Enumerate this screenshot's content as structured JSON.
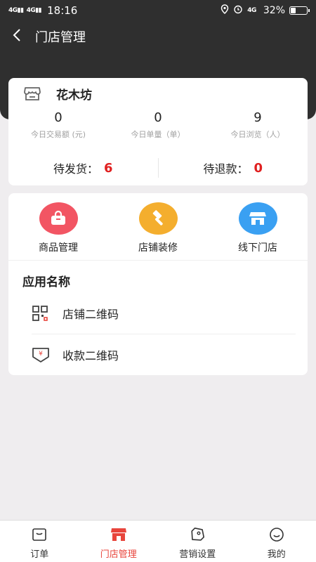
{
  "status_bar": {
    "signal_left": "4G",
    "signal_right": "4G",
    "time": "18:16",
    "network": "4G",
    "battery": "32%",
    "battery_level": 0.32
  },
  "nav": {
    "title": "门店管理"
  },
  "store": {
    "name": "花木坊",
    "stats": [
      {
        "value": "0",
        "label": "今日交易额 (元)"
      },
      {
        "value": "0",
        "label": "今日单量（单）"
      },
      {
        "value": "9",
        "label": "今日浏览（人）"
      }
    ],
    "pending_ship_label": "待发货：",
    "pending_ship_value": "6",
    "pending_refund_label": "待退款：",
    "pending_refund_value": "0"
  },
  "quick_actions": [
    {
      "label": "商品管理",
      "icon": "shopping-bag-icon",
      "color": "#f25563"
    },
    {
      "label": "店铺装修",
      "icon": "hammer-icon",
      "color": "#f4ae2e"
    },
    {
      "label": "线下门店",
      "icon": "storefront-icon",
      "color": "#3aa0f2"
    }
  ],
  "apps": {
    "title": "应用名称",
    "items": [
      {
        "label": "店铺二维码",
        "icon": "qr-code-icon"
      },
      {
        "label": "收款二维码",
        "icon": "payment-qr-icon"
      }
    ]
  },
  "tabs": [
    {
      "label": "订单",
      "icon": "order-icon",
      "active": false
    },
    {
      "label": "门店管理",
      "icon": "store-icon",
      "active": true
    },
    {
      "label": "营销设置",
      "icon": "tag-icon",
      "active": false
    },
    {
      "label": "我的",
      "icon": "profile-icon",
      "active": false
    }
  ],
  "colors": {
    "accent": "#e8453c",
    "header": "#2f2f2f",
    "value_red": "#e02020"
  }
}
